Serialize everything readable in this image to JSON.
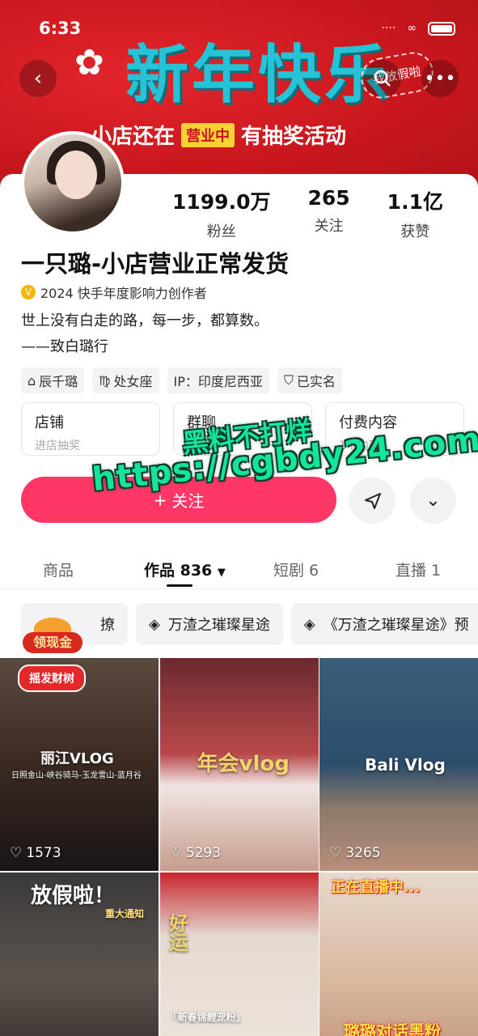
{
  "status_bar": {
    "time": "6:33"
  },
  "banner": {
    "title": "新年快乐",
    "sub_left": "小店还在",
    "sub_tag": "营业中",
    "sub_right": "有抽奖活动",
    "corner_text": "我放假啦"
  },
  "profile": {
    "stats": [
      {
        "num": "1199.0万",
        "label": "粉丝"
      },
      {
        "num": "265",
        "label": "关注"
      },
      {
        "num": "1.1亿",
        "label": "获赞"
      }
    ],
    "name": "一只璐-小店营业正常发货",
    "certification": "2024 快手年度影响力创作者",
    "bio_line1": "世上没有白走的路，每一步，都算数。",
    "bio_line2": "——致白璐行",
    "tags": [
      "辰千璐",
      "处女座",
      "IP：印度尼西亚",
      "已实名"
    ]
  },
  "entries": [
    {
      "title": "店铺",
      "sub": "进店抽奖"
    },
    {
      "title": "群聊",
      "sub": ""
    },
    {
      "title": "付费内容",
      "sub": "1个内容"
    }
  ],
  "actions": {
    "follow": "关注"
  },
  "watermark": {
    "line1": "黑料不打烊",
    "line2": "https://cgbdy24.com"
  },
  "tabs": [
    {
      "label": "商品"
    },
    {
      "label": "作品 836"
    },
    {
      "label": "短剧 6"
    },
    {
      "label": "直播 1"
    }
  ],
  "collections": [
    {
      "label": "撩"
    },
    {
      "label": "万渣之璀璨星途"
    },
    {
      "label": "《万渣之璀璨星途》预"
    }
  ],
  "gold_badge": "领现金",
  "videos": [
    {
      "likes": "1573",
      "caption": "丽江VLOG",
      "subcaption": "日照金山-峡谷骑马-玉龙雪山-蓝月谷",
      "badge": "摇发财树"
    },
    {
      "likes": "5293",
      "caption": "年会vlog"
    },
    {
      "likes": "3265",
      "caption": "Bali Vlog"
    },
    {
      "caption": "放假啦！",
      "subcaption": "重大通知"
    },
    {
      "caption": "好运",
      "subcaption": "「新春锦鲤宠粉」"
    },
    {
      "caption": "正在直播中...",
      "subcaption": "璐璐对话黑粉"
    }
  ],
  "colors": {
    "primary": "#fe3766",
    "banner": "#c8161d",
    "accent_title": "#26c3d6"
  }
}
